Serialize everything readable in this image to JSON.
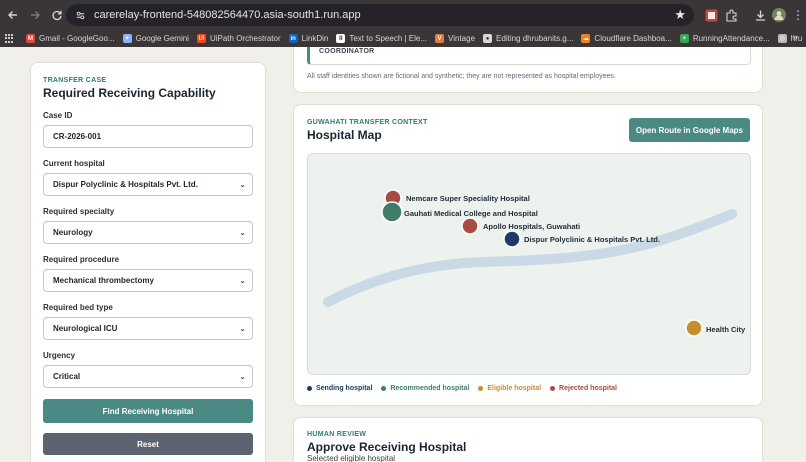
{
  "browser": {
    "url": "carerelay-frontend-548082564470.asia-south1.run.app",
    "bookmarks": [
      {
        "label": "Gmail - GoogleGoo...",
        "color": "#ea4335",
        "glyph": "M"
      },
      {
        "label": "Google Gemini",
        "color": "#8ab4f8",
        "glyph": "✦"
      },
      {
        "label": "UiPath Orchestrator",
        "color": "#fa4616",
        "glyph": "Ui"
      },
      {
        "label": "LinkDin",
        "color": "#0a66c2",
        "glyph": "in"
      },
      {
        "label": "Text to Speech | Ele...",
        "color": "#ffffff",
        "glyph": "II"
      },
      {
        "label": "Vintage",
        "color": "#e8793a",
        "glyph": "V"
      },
      {
        "label": "Editing dhrubanits.g...",
        "color": "#d9d5d7",
        "glyph": "●"
      },
      {
        "label": "Cloudflare Dashboa...",
        "color": "#f38020",
        "glyph": "☁"
      },
      {
        "label": "RunningAttendance...",
        "color": "#34a853",
        "glyph": "+"
      },
      {
        "label": "hru",
        "color": "#bdb8bb",
        "glyph": "◎"
      }
    ],
    "more_label": "»"
  },
  "top_card": {
    "coordinator_label": "COORDINATOR",
    "disclaimer": "All staff identities shown are fictional and synthetic; they are not represented as hospital employees."
  },
  "transfer": {
    "eyebrow": "TRANSFER CASE",
    "title": "Required Receiving Capability",
    "case_id_label": "Case ID",
    "case_id_value": "CR-2026-001",
    "hospital_label": "Current hospital",
    "hospital_value": "Dispur Polyclinic & Hospitals Pvt. Ltd.",
    "specialty_label": "Required specialty",
    "specialty_value": "Neurology",
    "procedure_label": "Required procedure",
    "procedure_value": "Mechanical thrombectomy",
    "bed_label": "Required bed type",
    "bed_value": "Neurological ICU",
    "urgency_label": "Urgency",
    "urgency_value": "Critical",
    "find_button": "Find Receiving Hospital",
    "reset_button": "Reset"
  },
  "map": {
    "eyebrow": "GUWAHATI TRANSFER CONTEXT",
    "title": "Hospital Map",
    "open_button": "Open Route in Google Maps",
    "hospitals": [
      {
        "name": "Nemcare Super Speciality Hospital",
        "status": "rejected"
      },
      {
        "name": "Gauhati Medical College and Hospital",
        "status": "recommended"
      },
      {
        "name": "Apollo Hospitals, Guwahati",
        "status": "rejected"
      },
      {
        "name": "Dispur Polyclinic & Hospitals Pvt. Ltd.",
        "status": "sending"
      },
      {
        "name": "Health City",
        "status": "eligible"
      }
    ],
    "legend": [
      {
        "label": "Sending hospital",
        "color": "#1f3a64"
      },
      {
        "label": "Recommended hospital",
        "color": "#3f7d68"
      },
      {
        "label": "Eligible hospital",
        "color": "#c4902f"
      },
      {
        "label": "Rejected hospital",
        "color": "#a84b43"
      }
    ],
    "colors": {
      "river": "#c9d9e5",
      "sending": "#1f3a64",
      "recommended": "#3f7d68",
      "eligible": "#c4902f",
      "rejected": "#a84b43"
    }
  },
  "review": {
    "eyebrow": "HUMAN REVIEW",
    "title": "Approve Receiving Hospital",
    "subtitle": "Selected eligible hospital"
  }
}
